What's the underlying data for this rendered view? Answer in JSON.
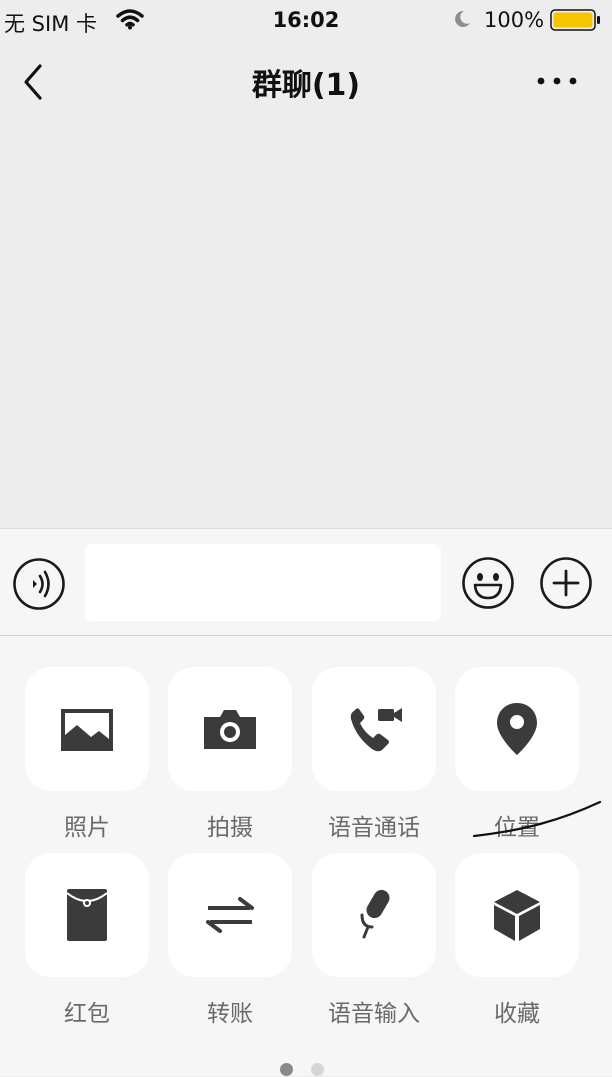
{
  "status": {
    "carrier": "无 SIM 卡",
    "time": "16:02",
    "battery": "100%",
    "battery_color": "#f7c402"
  },
  "nav": {
    "title": "群聊(1)",
    "back_icon": "chevron-left-icon",
    "more_icon": "more-dots-icon"
  },
  "input_bar": {
    "voice_icon": "voice-wave-icon",
    "text_value": "",
    "emoji_icon": "smiley-icon",
    "plus_icon": "plus-circle-icon"
  },
  "tools": [
    {
      "label": "照片",
      "icon": "photo-icon"
    },
    {
      "label": "拍摄",
      "icon": "camera-icon"
    },
    {
      "label": "语音通话",
      "icon": "call-video-icon"
    },
    {
      "label": "位置",
      "icon": "location-pin-icon"
    },
    {
      "label": "红包",
      "icon": "red-packet-icon"
    },
    {
      "label": "转账",
      "icon": "transfer-icon"
    },
    {
      "label": "语音输入",
      "icon": "microphone-icon"
    },
    {
      "label": "收藏",
      "icon": "favorites-box-icon"
    }
  ],
  "pager": {
    "pages": 2,
    "current": 1
  },
  "colors": {
    "icon": "#3b3b3b",
    "background": "#ededed",
    "panel": "#f6f6f6"
  }
}
